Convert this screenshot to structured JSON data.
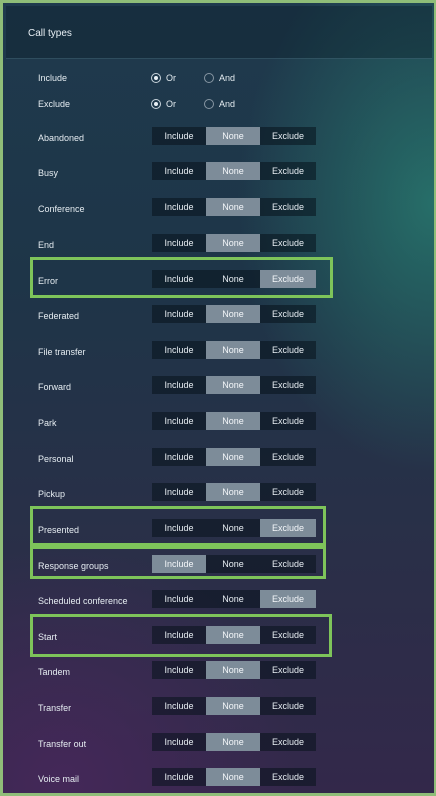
{
  "panel": {
    "title": "Call types",
    "include": {
      "label": "Include",
      "options": [
        "Or",
        "And"
      ],
      "selected": "Or"
    },
    "exclude": {
      "label": "Exclude",
      "options": [
        "Or",
        "And"
      ],
      "selected": "Or"
    },
    "option_labels": [
      "Include",
      "None",
      "Exclude"
    ],
    "rows": [
      {
        "label": "Abandoned",
        "selected": "None"
      },
      {
        "label": "Busy",
        "selected": "None"
      },
      {
        "label": "Conference",
        "selected": "None"
      },
      {
        "label": "End",
        "selected": "None"
      },
      {
        "label": "Error",
        "selected": "Exclude",
        "highlighted": true
      },
      {
        "label": "Federated",
        "selected": "None"
      },
      {
        "label": "File transfer",
        "selected": "None"
      },
      {
        "label": "Forward",
        "selected": "None"
      },
      {
        "label": "Park",
        "selected": "None"
      },
      {
        "label": "Personal",
        "selected": "None"
      },
      {
        "label": "Pickup",
        "selected": "None"
      },
      {
        "label": "Presented",
        "selected": "Exclude",
        "highlighted": true
      },
      {
        "label": "Response groups",
        "selected": "Include",
        "highlighted": true
      },
      {
        "label": "Scheduled conference",
        "selected": "Exclude"
      },
      {
        "label": "Start",
        "selected": "None",
        "highlighted": true
      },
      {
        "label": "Tandem",
        "selected": "None"
      },
      {
        "label": "Transfer",
        "selected": "None"
      },
      {
        "label": "Transfer out",
        "selected": "None"
      },
      {
        "label": "Voice mail",
        "selected": "None"
      }
    ]
  },
  "colors": {
    "highlight_box": "#7ec45a",
    "selected_segment": "#7d8c99",
    "frame_border": "#8fbd78"
  }
}
